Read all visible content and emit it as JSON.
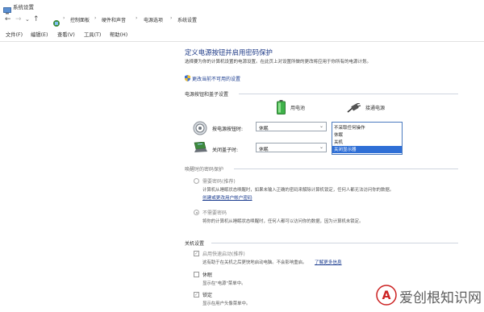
{
  "window": {
    "title": "系统设置"
  },
  "address": {
    "back": "←",
    "forward": "→",
    "recent": "⌄",
    "up": "↑",
    "crumbs": [
      "控制面板",
      "硬件和声音",
      "电源选项",
      "系统设置"
    ],
    "separator": "›"
  },
  "menu": [
    "文件(F)",
    "编辑(E)",
    "查看(V)",
    "工具(T)",
    "帮助(H)"
  ],
  "page": {
    "heading": "定义电源按钮并启用密码保护",
    "description": "选择要为你的计算机设置的电源设置。在此页上对设置所做的更改将应用于你所有的电源计划。",
    "change_link": "更改当前不可用的设置"
  },
  "power_section": {
    "title": "电源按钮和盖子设置",
    "battery_label": "用电池",
    "plugged_label": "接通电源",
    "rows": [
      {
        "label": "按电源按钮时:",
        "battery_value": "休眠",
        "plugged_value": "不采取任何操作"
      },
      {
        "label": "关闭盖子时:",
        "battery_value": "休眠",
        "plugged_value": ""
      }
    ],
    "dropdown_options": [
      "不采取任何操作",
      "休眠",
      "关机",
      "关闭显示器"
    ],
    "dropdown_selected_index": 3
  },
  "password_section": {
    "title": "唤醒时的密码保护",
    "opt1_label": "需要密码(推荐)",
    "opt1_text": "计算机从睡眠状态唤醒时，如果未输入正确的密码来解除计算机锁定，任何人都无法访问你的数据。",
    "opt1_link": "创建或更改用户帐户密码",
    "opt2_label": "不需要密码",
    "opt2_text": "将你的计算机从睡眠状态唤醒时，任何人都可以访问你的数据，因为计算机未锁定。"
  },
  "shutdown_section": {
    "title": "关机设置",
    "fast_label": "启用快速启动(推荐)",
    "fast_text": "这有助于在关机之后更快地启动电脑。不会影响重启。",
    "fast_link": "了解更多信息",
    "hibernate_label": "休眠",
    "hibernate_text": "显示在\"电源\"菜单中。",
    "lock_label": "锁定",
    "lock_text": "显示在用户头像菜单中。"
  },
  "watermark": {
    "text": "爱创根知识网",
    "logo_char": "A"
  },
  "colors": {
    "accent": "#2f6fd6",
    "heading": "#1e3a87",
    "link": "#1a3b8f"
  }
}
